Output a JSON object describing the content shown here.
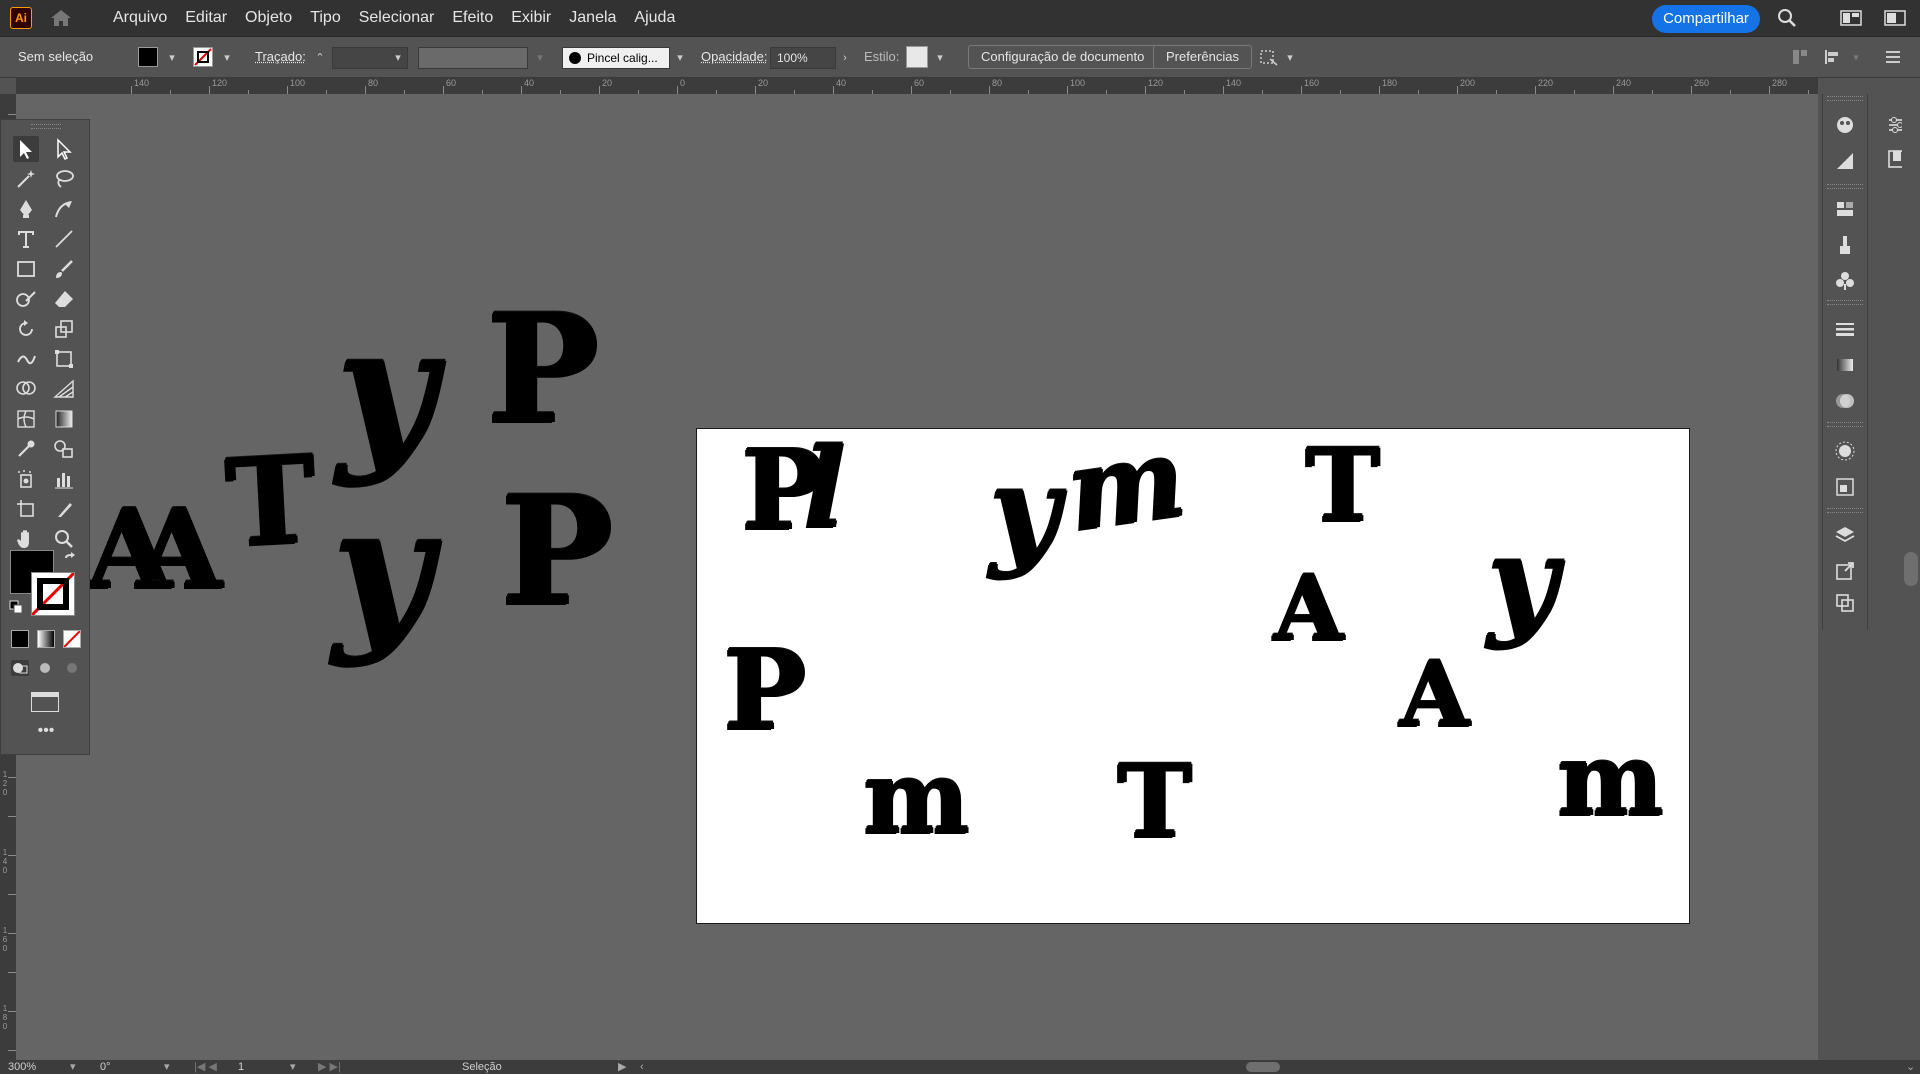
{
  "app": {
    "logo": "Ai",
    "share_label": "Compartilhar"
  },
  "menu": [
    "Arquivo",
    "Editar",
    "Objeto",
    "Tipo",
    "Selecionar",
    "Efeito",
    "Exibir",
    "Janela",
    "Ajuda"
  ],
  "control": {
    "selection": "Sem seleção",
    "stroke_label": "Traçado:",
    "brush_label": "Pincel calig...",
    "opacity_label": "Opacidade:",
    "opacity_value": "100%",
    "style_label": "Estilo:",
    "doc_setup": "Configuração de documento",
    "preferences": "Preferências"
  },
  "ruler": {
    "h_labels": [
      "140",
      "120",
      "100",
      "80",
      "60",
      "40",
      "20",
      "0",
      "20",
      "40",
      "60",
      "80",
      "100",
      "120",
      "140",
      "160",
      "180",
      "200",
      "220",
      "240",
      "260",
      "280"
    ],
    "v_labels": [
      "120",
      "140",
      "160",
      "180"
    ]
  },
  "artwork": {
    "pasteboard_letters": [
      "A",
      "A",
      "T",
      "y",
      "P",
      "y",
      "P"
    ],
    "artboard_letters": [
      "P",
      "l",
      "y",
      "m",
      "T",
      "A",
      "y",
      "P",
      "A",
      "m",
      "T",
      "m"
    ]
  },
  "status": {
    "zoom": "300%",
    "rotation": "0°",
    "artboard_num": "1",
    "mode": "Seleção"
  },
  "colors": {
    "accent": "#1473e6",
    "menubar": "#323232",
    "canvas": "#656565",
    "artboard": "#ffffff"
  }
}
